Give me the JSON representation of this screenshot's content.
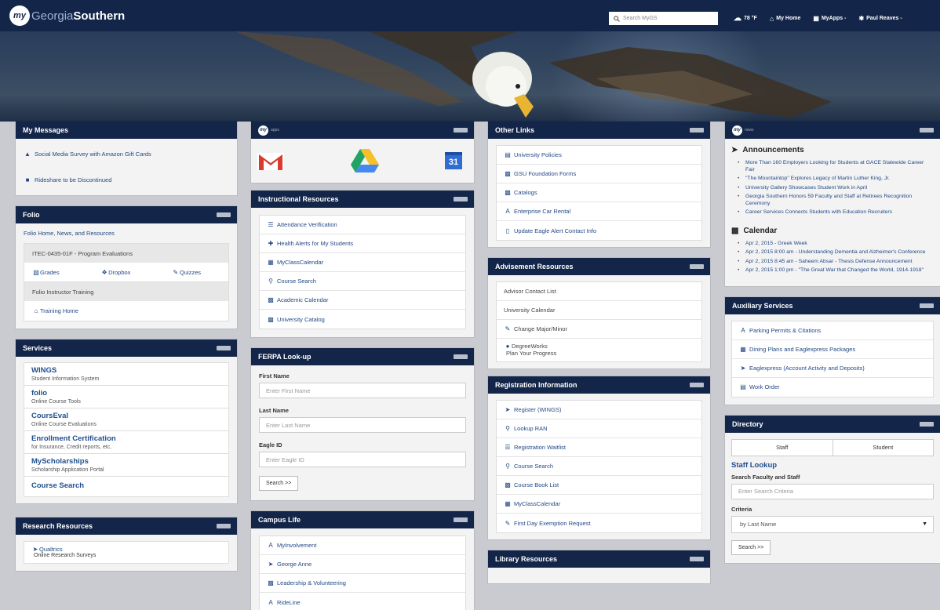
{
  "header": {
    "logo_badge": "my",
    "logo_prefix": "Georgia",
    "logo_suffix": "Southern",
    "search_placeholder": "Search MyGS",
    "weather": "78 °F",
    "my_home": "My Home",
    "my_apps": "MyApps -",
    "user": "Paul Reaves -"
  },
  "colors": {
    "nav": "#132649",
    "link": "#234a86",
    "service_title": "#1f4e8c"
  },
  "my_messages": {
    "title": "My Messages",
    "items": [
      {
        "icon": "bag-icon",
        "label": "Social Media Survey with Amazon Gift Cards"
      },
      {
        "icon": "car-icon",
        "label": "Rideshare to be Discontinued"
      }
    ]
  },
  "folio": {
    "title": "Folio",
    "home_link": "Folio Home, News, and Resources",
    "course": "ITEC-0435-01F - Program Evaluations",
    "links": [
      {
        "icon": "chart-icon",
        "label": "Grades"
      },
      {
        "icon": "dropbox-icon",
        "label": "Dropbox"
      },
      {
        "icon": "pencil-icon",
        "label": "Quizzes"
      }
    ],
    "training_header": "Folio Instructor Training",
    "training_link": "Training Home"
  },
  "services": {
    "title": "Services",
    "items": [
      {
        "title": "WINGS",
        "sub": "Student Information System"
      },
      {
        "title": "folio",
        "sub": "Online Course Tools"
      },
      {
        "title": "CoursEval",
        "sub": "Online Course Evaluations"
      },
      {
        "title": "Enrollment Certification",
        "sub": "for Insurance, Credit reports, etc."
      },
      {
        "title": "MyScholarships",
        "sub": "Scholarship Application Portal"
      },
      {
        "title": "Course Search",
        "sub": ""
      }
    ]
  },
  "research": {
    "title": "Research Resources",
    "item_title": "Qualtrics",
    "item_sub": "Online Research Surveys"
  },
  "apps": {
    "badge": "my",
    "title": "apps",
    "icons": [
      "gmail-icon",
      "drive-icon",
      "calendar-icon"
    ],
    "calendar_day": "31"
  },
  "instructional": {
    "title": "Instructional Resources",
    "items": [
      {
        "icon": "list-icon",
        "label": "Attendance Verification"
      },
      {
        "icon": "plus-icon",
        "label": "Health Alerts for My Students"
      },
      {
        "icon": "grid-icon",
        "label": "MyClassCalendar"
      },
      {
        "icon": "search-icon",
        "label": "Course Search"
      },
      {
        "icon": "calendar-icon",
        "label": "Academic Calendar"
      },
      {
        "icon": "book-icon",
        "label": "University Catalog"
      }
    ]
  },
  "ferpa": {
    "title": "FERPA Look-up",
    "first_label": "First Name",
    "first_placeholder": "Enter First Name",
    "last_label": "Last Name",
    "last_placeholder": "Enter Last Name",
    "eagle_label": "Eagle ID",
    "eagle_placeholder": "Enter Eagle ID",
    "search_button": "Search >>"
  },
  "campus_life": {
    "title": "Campus Life",
    "items": [
      {
        "icon": "a-icon",
        "label": "MyInvolvement"
      },
      {
        "icon": "bullhorn-icon",
        "label": "George Anne"
      },
      {
        "icon": "building-icon",
        "label": "Leadership & Volunteering"
      },
      {
        "icon": "a-icon",
        "label": "RideLine"
      }
    ]
  },
  "other_links": {
    "title": "Other Links",
    "items": [
      {
        "icon": "doc-icon",
        "label": "University Policies"
      },
      {
        "icon": "building-icon",
        "label": "GSU Foundation Forms"
      },
      {
        "icon": "book-icon",
        "label": "Catalogs"
      },
      {
        "icon": "a-icon",
        "label": "Enterprise Car Rental"
      },
      {
        "icon": "phone-icon",
        "label": "Update Eagle Alert Contact Info"
      }
    ]
  },
  "advisement": {
    "title": "Advisement Resources",
    "items": [
      {
        "icon": "",
        "label": "Advisor Contact List",
        "sub": ""
      },
      {
        "icon": "",
        "label": "University Calendar",
        "sub": ""
      },
      {
        "icon": "pencil-icon",
        "label": "Change Major/Minor",
        "sub": ""
      },
      {
        "icon": "pin-icon",
        "label": "DegreeWorks",
        "sub": "Plan Your Progress"
      }
    ]
  },
  "registration": {
    "title": "Registration Information",
    "items": [
      {
        "icon": "bullhorn-icon",
        "label": "Register (WINGS)"
      },
      {
        "icon": "search-icon",
        "label": "Lookup RAN"
      },
      {
        "icon": "list-icon",
        "label": "Registration Waitlist"
      },
      {
        "icon": "search-icon",
        "label": "Course Search"
      },
      {
        "icon": "book-icon",
        "label": "Course Book List"
      },
      {
        "icon": "grid-icon",
        "label": "MyClassCalendar"
      },
      {
        "icon": "pencil-icon",
        "label": "First Day Exemption Request"
      }
    ]
  },
  "library": {
    "title": "Library Resources"
  },
  "news": {
    "badge": "my",
    "title": "news",
    "announcements_title": "Announcements",
    "announcements": [
      "More Than 160 Employers Looking for Students at GACE Statewide Career Fair",
      "\"The Mountaintop\" Explores Legacy of Martin Luther King, Jr.",
      "University Gallery Showcases Student Work in April",
      "Georgia Southern Honors 59 Faculty and Staff at Retirees Recognition Ceremony",
      "Career Services Connects Students with Education Recruiters"
    ],
    "calendar_title": "Calendar",
    "calendar": [
      "Apr 2, 2015 - Greek Week",
      "Apr 2, 2015 8:00 am - Understanding Dementia and Alzheimer's Conference",
      "Apr 2, 2015 8:45 am - Saheem Absar - Thesis Defense Announcement",
      "Apr 2, 2015 1:00 pm - \"The Great War that Changed the World, 1914-1918\""
    ]
  },
  "auxiliary": {
    "title": "Auxiliary Services",
    "items": [
      {
        "icon": "a-icon",
        "label": "Parking Permits & Citations"
      },
      {
        "icon": "dining-icon",
        "label": "Dining Plans and Eaglexpress Packages"
      },
      {
        "icon": "card-icon",
        "label": "Eaglexpress (Account Activity and Deposits)"
      },
      {
        "icon": "doc-icon",
        "label": "Work Order"
      }
    ]
  },
  "directory": {
    "title": "Directory",
    "tabs": [
      "Staff",
      "Student"
    ],
    "lookup_title": "Staff Lookup",
    "search_label": "Search Faculty and Staff",
    "search_placeholder": "Enter Search Criteria",
    "criteria_label": "Criteria",
    "criteria_value": "by Last Name",
    "search_button": "Search >>"
  }
}
